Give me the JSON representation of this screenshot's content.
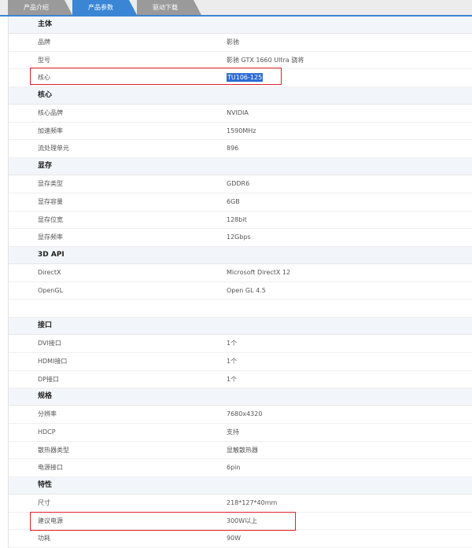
{
  "tabs": [
    {
      "label": "产品介绍",
      "active": false
    },
    {
      "label": "产品参数",
      "active": true
    },
    {
      "label": "驱动下载",
      "active": false
    }
  ],
  "sections": [
    {
      "title": "主体",
      "rows": [
        {
          "key": "品牌",
          "value": "影驰"
        },
        {
          "key": "型号",
          "value": "影驰 GTX 1660 Ultra 骁将"
        },
        {
          "key": "核心",
          "value": "TU106-125"
        }
      ]
    },
    {
      "title": "核心",
      "rows": [
        {
          "key": "核心品牌",
          "value": "NVIDIA"
        },
        {
          "key": "加速频率",
          "value": "1590MHz"
        },
        {
          "key": "流处理单元",
          "value": "896"
        }
      ]
    },
    {
      "title": "显存",
      "rows": [
        {
          "key": "显存类型",
          "value": "GDDR6"
        },
        {
          "key": "显存容量",
          "value": "6GB"
        },
        {
          "key": "显存位宽",
          "value": "128bit"
        },
        {
          "key": "显存频率",
          "value": "12Gbps"
        }
      ]
    },
    {
      "title": "3D API",
      "rows": [
        {
          "key": "DirectX",
          "value": "Microsoft DirectX 12"
        },
        {
          "key": "OpenGL",
          "value": "Open GL 4.5"
        }
      ]
    },
    {
      "title": "接口",
      "rows": [
        {
          "key": "DVI接口",
          "value": "1个"
        },
        {
          "key": "HDMI接口",
          "value": "1个"
        },
        {
          "key": "DP接口",
          "value": "1个"
        }
      ]
    },
    {
      "title": "规格",
      "rows": [
        {
          "key": "分辨率",
          "value": "7680x4320"
        },
        {
          "key": "HDCP",
          "value": "支持"
        },
        {
          "key": "散热器类型",
          "value": "显触散热器"
        },
        {
          "key": "电源接口",
          "value": "6pin"
        }
      ]
    },
    {
      "title": "特性",
      "rows": [
        {
          "key": "尺寸",
          "value": "218*127*40mm"
        },
        {
          "key": "建议电源",
          "value": "300W以上"
        },
        {
          "key": "功耗",
          "value": "90W"
        }
      ]
    }
  ],
  "colors": {
    "accent": "#3a86d4",
    "highlight_box": "#e0202a",
    "selection": "#2d6bd3"
  }
}
